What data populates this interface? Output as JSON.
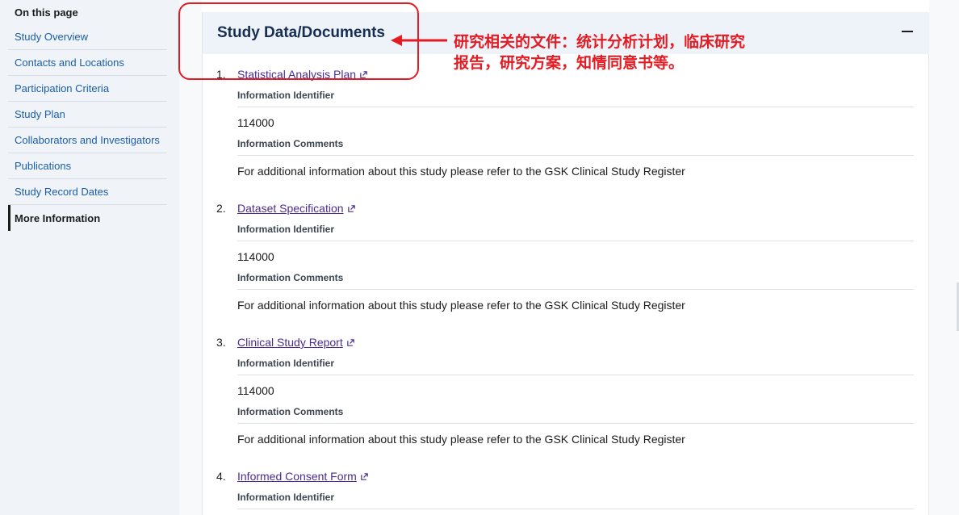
{
  "sidebar": {
    "title": "On this page",
    "items": [
      {
        "label": "Study Overview"
      },
      {
        "label": "Contacts and Locations"
      },
      {
        "label": "Participation Criteria"
      },
      {
        "label": "Study Plan"
      },
      {
        "label": "Collaborators and Investigators"
      },
      {
        "label": "Publications"
      },
      {
        "label": "Study Record Dates"
      },
      {
        "label": "More Information",
        "active": true
      }
    ]
  },
  "section": {
    "title": "Study Data/Documents",
    "collapse_icon": "minus-icon",
    "documents": [
      {
        "number": "1.",
        "name": "Statistical Analysis Plan",
        "identifier_label": "Information Identifier",
        "identifier": "114000",
        "comments_label": "Information Comments",
        "comments": "For additional information about this study please refer to the GSK Clinical Study Register"
      },
      {
        "number": "2.",
        "name": "Dataset Specification",
        "identifier_label": "Information Identifier",
        "identifier": "114000",
        "comments_label": "Information Comments",
        "comments": "For additional information about this study please refer to the GSK Clinical Study Register"
      },
      {
        "number": "3.",
        "name": "Clinical Study Report",
        "identifier_label": "Information Identifier",
        "identifier": "114000",
        "comments_label": "Information Comments",
        "comments": "For additional information about this study please refer to the GSK Clinical Study Register"
      },
      {
        "number": "4.",
        "name": "Informed Consent Form",
        "identifier_label": "Information Identifier"
      }
    ]
  },
  "annotation": {
    "line1": "研究相关的文件：统计分析计划，临床研究",
    "line2": "报告，研究方案，知情同意书等。",
    "color": "#e31b23"
  },
  "colors": {
    "link": "#4c2c92",
    "nav_link": "#1a5da8",
    "sidebar_bg": "#f0f4f9",
    "header_bg": "#eef3f9",
    "title": "#162e51"
  }
}
